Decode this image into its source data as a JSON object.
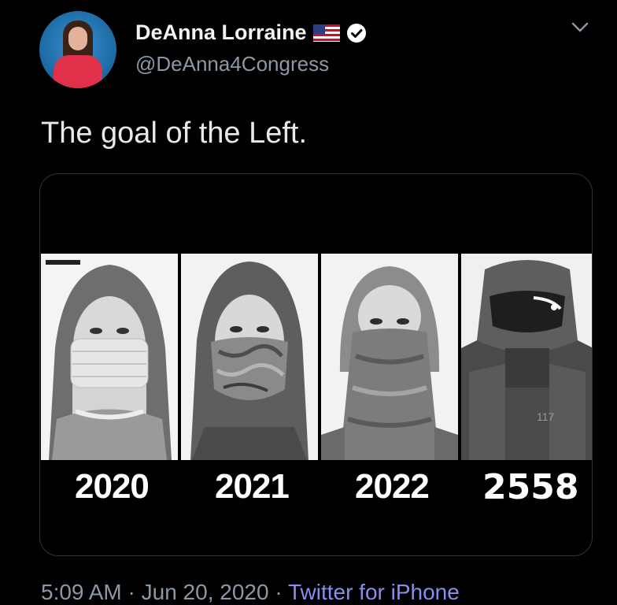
{
  "author": {
    "display_name": "DeAnna Lorraine",
    "handle": "@DeAnna4Congress",
    "badges": [
      "us-flag-icon",
      "verified-icon"
    ]
  },
  "tweet": {
    "text": "The goal of the Left."
  },
  "media": {
    "panels": [
      {
        "year": "2020",
        "subject": "surgical-mask"
      },
      {
        "year": "2021",
        "subject": "patterned-cloth-mask"
      },
      {
        "year": "2022",
        "subject": "full-face-gaiter"
      },
      {
        "year": "2558",
        "subject": "armored-helmet"
      }
    ]
  },
  "meta": {
    "time": "5:09 AM",
    "separator": "·",
    "date": "Jun 20, 2020",
    "source": "Twitter for iPhone"
  },
  "colors": {
    "background": "#000000",
    "text": "#e7e9ea",
    "secondary": "#8b98a5",
    "link": "#8b8cf0",
    "border": "#2f3336"
  }
}
